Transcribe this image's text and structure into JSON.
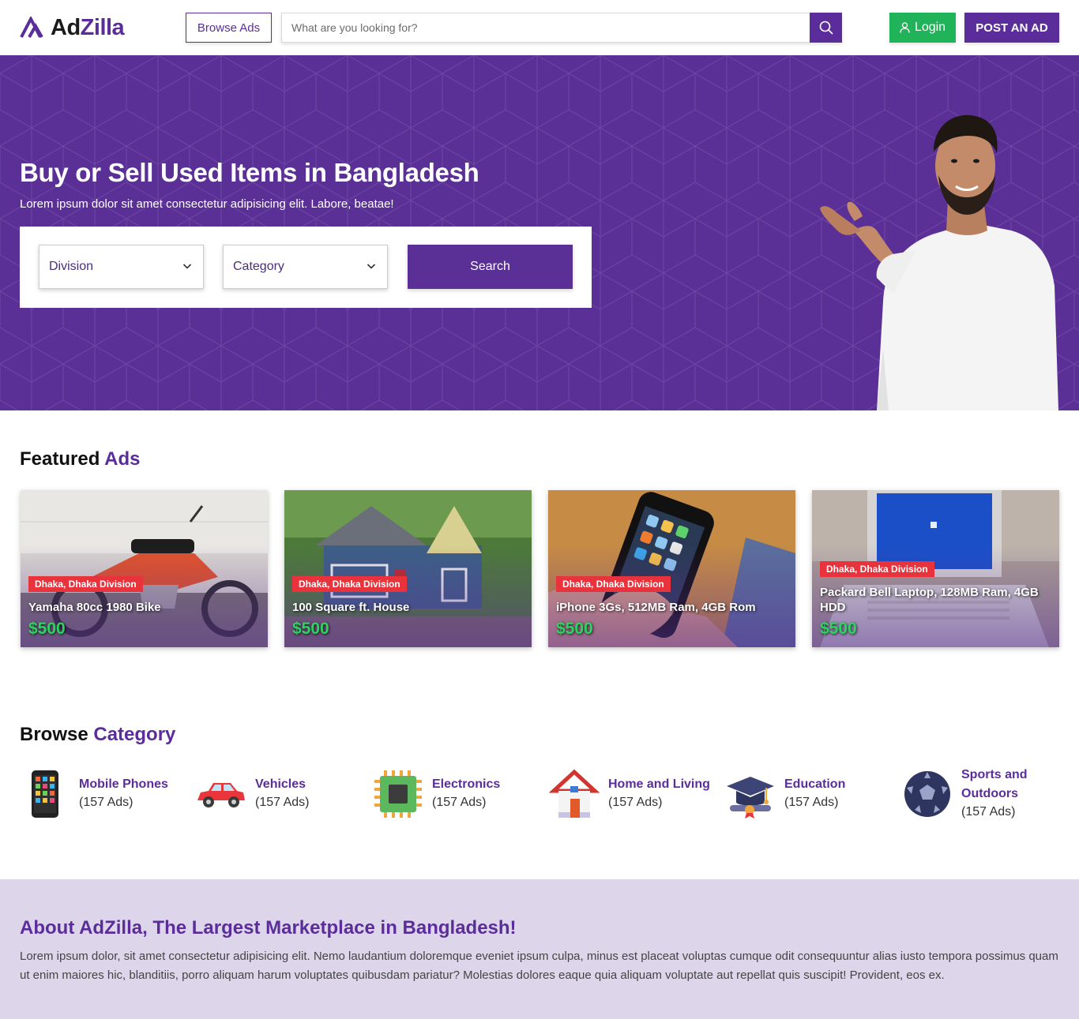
{
  "header": {
    "logo_ad": "Ad",
    "logo_zilla": "Zilla",
    "browse_label": "Browse Ads",
    "search_placeholder": "What are you looking for?",
    "login_label": "Login",
    "post_label": "POST AN AD"
  },
  "hero": {
    "title": "Buy or Sell Used Items in Bangladesh",
    "subtitle": "Lorem ipsum dolor sit amet consectetur adipisicing elit. Labore, beatae!",
    "division_label": "Division",
    "category_label": "Category",
    "search_label": "Search"
  },
  "featured": {
    "title_a": "Featured",
    "title_b": "Ads",
    "ads": [
      {
        "location": "Dhaka, Dhaka Division",
        "title": "Yamaha 80cc 1980 Bike",
        "price": "$500"
      },
      {
        "location": "Dhaka, Dhaka Division",
        "title": "100 Square ft. House",
        "price": "$500"
      },
      {
        "location": "Dhaka, Dhaka Division",
        "title": "iPhone 3Gs, 512MB Ram, 4GB Rom",
        "price": "$500"
      },
      {
        "location": "Dhaka, Dhaka Division",
        "title": "Packard Bell Laptop, 128MB Ram, 4GB HDD",
        "price": "$500"
      }
    ]
  },
  "categories": {
    "title_a": "Browse",
    "title_b": "Category",
    "items": [
      {
        "name": "Mobile Phones",
        "count": "(157 Ads)",
        "icon": "mobile-phone-icon"
      },
      {
        "name": "Vehicles",
        "count": "(157 Ads)",
        "icon": "car-icon"
      },
      {
        "name": "Electronics",
        "count": "(157 Ads)",
        "icon": "chip-icon"
      },
      {
        "name": "Home and Living",
        "count": "(157 Ads)",
        "icon": "house-icon"
      },
      {
        "name": "Education",
        "count": "(157 Ads)",
        "icon": "graduation-cap-icon"
      },
      {
        "name": "Sports and Outdoors",
        "count": "(157 Ads)",
        "icon": "ball-icon"
      }
    ]
  },
  "about": {
    "title": "About AdZilla, The Largest Marketplace in Bangladesh!",
    "text": "Lorem ipsum dolor, sit amet consectetur adipisicing elit. Nemo laudantium doloremque eveniet ipsum culpa, minus est placeat voluptas cumque odit consequuntur alias iusto tempora possimus quam ut enim maiores hic, blanditiis, porro aliquam harum voluptates quibusdam pariatur? Molestias dolores eaque quia aliquam voluptate aut repellat quis suscipit! Provident, eos ex."
  },
  "colors": {
    "brand_purple": "#5b2d9a",
    "hero_purple": "#5a2f96",
    "login_green": "#21b35a",
    "location_red": "#e8323c",
    "price_green": "#2bd45e",
    "about_bg": "#ddd6ea"
  }
}
